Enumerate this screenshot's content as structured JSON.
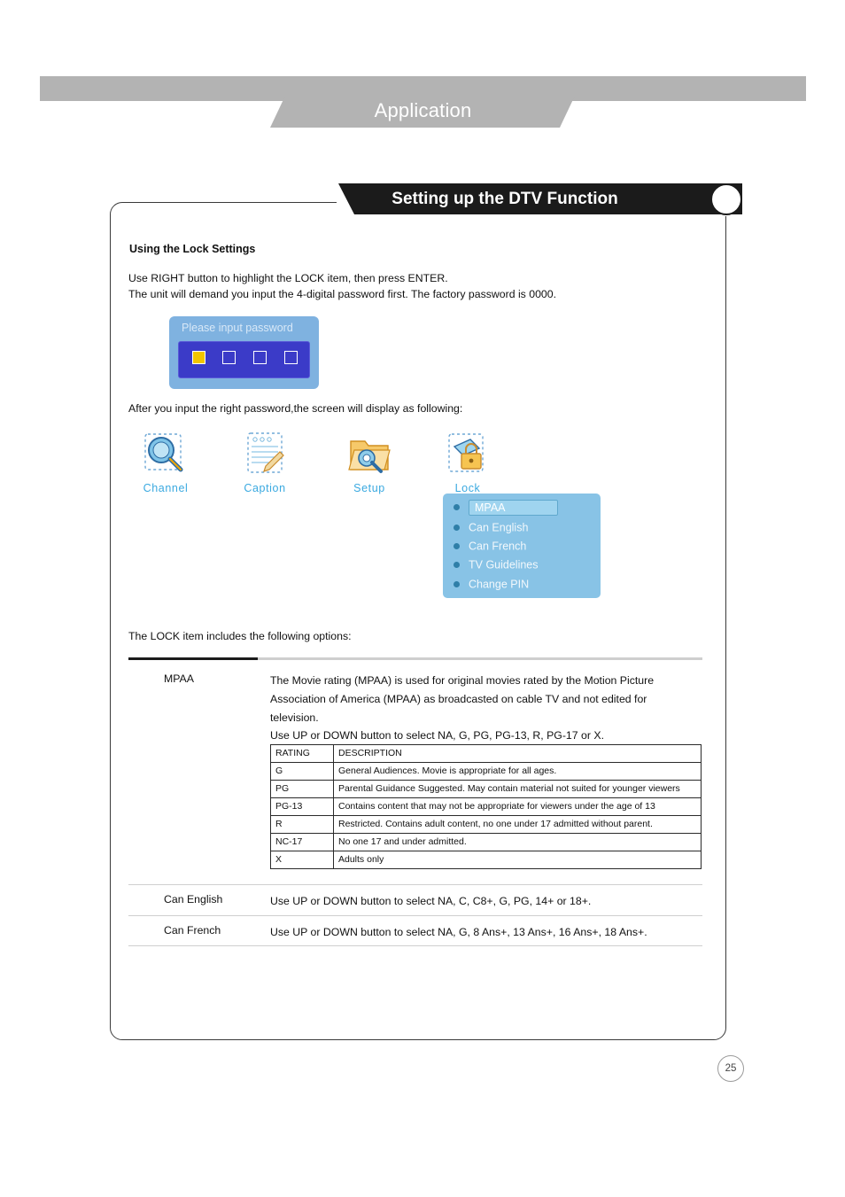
{
  "header": {
    "chapter_title": "Application"
  },
  "section": {
    "title": "Setting up the DTV Function"
  },
  "body": {
    "subhead": "Using the Lock Settings",
    "intro_line1": "Use RIGHT button to highlight the LOCK item, then press ENTER.",
    "intro_line2": "The unit will demand you input the 4-digital password first. The factory password is 0000.",
    "after_password": "After you input the right password,the screen will display as following:",
    "lock_options_intro": "The LOCK item includes the following options:"
  },
  "password_osd": {
    "prompt": "Please input password",
    "cells": [
      "filled",
      "empty",
      "empty",
      "empty"
    ]
  },
  "icons": [
    {
      "icon": "magnifier-channel-icon",
      "label": "Channel"
    },
    {
      "icon": "caption-page-icon",
      "label": "Caption"
    },
    {
      "icon": "setup-folder-icon",
      "label": "Setup"
    },
    {
      "icon": "lock-padlock-icon",
      "label": "Lock"
    }
  ],
  "lock_menu": {
    "items": [
      {
        "label": "MPAA",
        "selected": true
      },
      {
        "label": "Can English",
        "selected": false
      },
      {
        "label": "Can French",
        "selected": false
      },
      {
        "label": "TV Guidelines",
        "selected": false
      },
      {
        "label": "Change PIN",
        "selected": false
      }
    ]
  },
  "options": {
    "mpaa": {
      "label": "MPAA",
      "desc_line1": "The Movie rating (MPAA) is used for original movies rated by the Motion Picture",
      "desc_line2": "Association of America (MPAA) as broadcasted on cable TV and not edited for",
      "desc_line3": "television.",
      "desc_line4": "Use UP or DOWN button to select NA, G, PG, PG-13, R, PG-17 or X."
    },
    "can_english": {
      "label": "Can English",
      "desc": "Use UP or DOWN button to select NA, C, C8+, G, PG, 14+ or 18+."
    },
    "can_french": {
      "label": "Can French",
      "desc": "Use UP or DOWN button to select NA, G, 8 Ans+, 13 Ans+, 16 Ans+, 18 Ans+."
    }
  },
  "rating_table": {
    "headers": [
      "RATING",
      "DESCRIPTION"
    ],
    "rows": [
      [
        "G",
        "General Audiences. Movie is appropriate for all ages."
      ],
      [
        "PG",
        "Parental Guidance Suggested. May contain material not suited for younger viewers"
      ],
      [
        "PG-13",
        "Contains content that may not be appropriate for viewers under the age of 13"
      ],
      [
        "R",
        "Restricted. Contains adult content, no one under 17 admitted without parent."
      ],
      [
        "NC-17",
        "No one 17 and under admitted."
      ],
      [
        "X",
        "Adults only"
      ]
    ]
  },
  "footer": {
    "page_number": "25"
  }
}
